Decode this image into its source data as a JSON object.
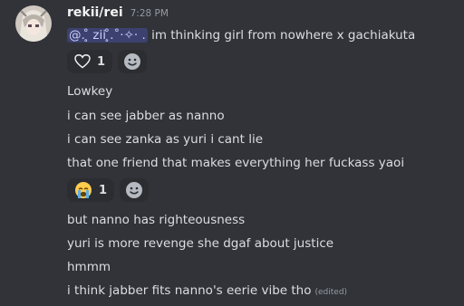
{
  "message": {
    "author": "rekii/rei",
    "timestamp": "7:28 PM",
    "mention": "@.  ̥̊ zii  ̥̊.˚·✧·  .",
    "first_line_text": " im thinking girl from nowhere x gachiakuta",
    "reactions_1": [
      {
        "icon": "heart-outline-icon",
        "count": "1"
      }
    ],
    "lines_group_1": [
      "Lowkey",
      "i can see jabber as nanno",
      "i can see zanka as yuri i cant lie",
      "that one friend that makes everything her fuckass yaoi"
    ],
    "reactions_2": [
      {
        "icon": "crying-emoji-icon",
        "count": "1"
      }
    ],
    "lines_group_2": [
      "but nanno has righteousness",
      "yuri is more revenge she dgaf about justice",
      "hmmm",
      "i think jabber fits nanno's eerie vibe tho"
    ],
    "edited_label": "(edited)"
  },
  "colors": {
    "background": "#313338",
    "username": "#f2f3f5",
    "text": "#dbdee1",
    "muted": "#949ba4",
    "mention_bg": "#3f4480",
    "reaction_bg": "#2b2d31"
  }
}
